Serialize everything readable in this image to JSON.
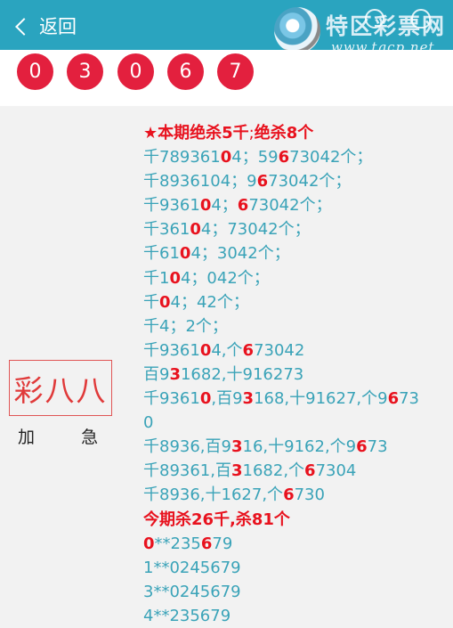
{
  "header": {
    "back_label": "返回",
    "logo_name": "特区彩票网",
    "logo_url": "www.tqcp.net"
  },
  "balls": [
    "0",
    "3",
    "0",
    "6",
    "7"
  ],
  "side": {
    "stamp": "彩八八",
    "caption_left": "加",
    "caption_right": "急"
  },
  "lines": [
    {
      "type": "title",
      "segments": [
        {
          "t": "★本期绝杀5千",
          "h": false
        },
        {
          "t": ";",
          "h": false,
          "thin": true
        },
        {
          "t": "绝杀8个",
          "h": false
        }
      ]
    },
    {
      "type": "body",
      "segments": [
        {
          "t": "千789361",
          "h": false
        },
        {
          "t": "0",
          "h": true
        },
        {
          "t": "4；59",
          "h": false
        },
        {
          "t": "6",
          "h": true
        },
        {
          "t": "73042个；",
          "h": false
        }
      ]
    },
    {
      "type": "body",
      "segments": [
        {
          "t": "千893610",
          "h": false
        },
        {
          "t": "4；9",
          "h": false
        },
        {
          "t": "6",
          "h": true
        },
        {
          "t": "73042个；",
          "h": false
        }
      ]
    },
    {
      "type": "body",
      "segments": [
        {
          "t": "千9361",
          "h": false
        },
        {
          "t": "0",
          "h": true
        },
        {
          "t": "4；",
          "h": false
        },
        {
          "t": "6",
          "h": true
        },
        {
          "t": "73042个；",
          "h": false
        }
      ]
    },
    {
      "type": "body",
      "segments": [
        {
          "t": "千361",
          "h": false
        },
        {
          "t": "0",
          "h": true
        },
        {
          "t": "4；73042个；",
          "h": false
        }
      ]
    },
    {
      "type": "body",
      "segments": [
        {
          "t": "千61",
          "h": false
        },
        {
          "t": "0",
          "h": true
        },
        {
          "t": "4；3042个；",
          "h": false
        }
      ]
    },
    {
      "type": "body",
      "segments": [
        {
          "t": "千1",
          "h": false
        },
        {
          "t": "0",
          "h": true
        },
        {
          "t": "4；042个；",
          "h": false
        }
      ]
    },
    {
      "type": "body",
      "segments": [
        {
          "t": "千",
          "h": false
        },
        {
          "t": "0",
          "h": true
        },
        {
          "t": "4；42个；",
          "h": false
        }
      ]
    },
    {
      "type": "body",
      "segments": [
        {
          "t": "千4；2个；",
          "h": false
        }
      ]
    },
    {
      "type": "body",
      "segments": [
        {
          "t": "千9361",
          "h": false
        },
        {
          "t": "0",
          "h": true
        },
        {
          "t": "4,个",
          "h": false
        },
        {
          "t": "6",
          "h": true
        },
        {
          "t": "73042",
          "h": false
        }
      ]
    },
    {
      "type": "body",
      "segments": [
        {
          "t": "百9",
          "h": false
        },
        {
          "t": "3",
          "h": true
        },
        {
          "t": "1682,十916273",
          "h": false
        }
      ]
    },
    {
      "type": "body",
      "segments": [
        {
          "t": "千9361",
          "h": false
        },
        {
          "t": "0",
          "h": true
        },
        {
          "t": ",百9",
          "h": false
        },
        {
          "t": "3",
          "h": true
        },
        {
          "t": "168,十91627,个9",
          "h": false
        },
        {
          "t": "6",
          "h": true
        },
        {
          "t": "73",
          "h": false
        }
      ]
    },
    {
      "type": "body",
      "segments": [
        {
          "t": "0",
          "h": false
        }
      ]
    },
    {
      "type": "body",
      "segments": [
        {
          "t": "千8936,百9",
          "h": false
        },
        {
          "t": "3",
          "h": true
        },
        {
          "t": "16,十9162,个9",
          "h": false
        },
        {
          "t": "6",
          "h": true
        },
        {
          "t": "73",
          "h": false
        }
      ]
    },
    {
      "type": "body",
      "segments": [
        {
          "t": "千89361,百",
          "h": false
        },
        {
          "t": "3",
          "h": true
        },
        {
          "t": "1682,个",
          "h": false
        },
        {
          "t": "6",
          "h": true
        },
        {
          "t": "7304",
          "h": false
        }
      ]
    },
    {
      "type": "body",
      "segments": [
        {
          "t": "千8936,十1627,个",
          "h": false
        },
        {
          "t": "6",
          "h": true
        },
        {
          "t": "730",
          "h": false
        }
      ]
    },
    {
      "type": "title",
      "segments": [
        {
          "t": "今期杀26千,杀81个",
          "h": false
        }
      ]
    },
    {
      "type": "body",
      "segments": [
        {
          "t": "0",
          "h": true
        },
        {
          "t": "**235",
          "h": false
        },
        {
          "t": "6",
          "h": true
        },
        {
          "t": "79",
          "h": false
        }
      ]
    },
    {
      "type": "body",
      "segments": [
        {
          "t": "1**0245679",
          "h": false
        }
      ]
    },
    {
      "type": "body",
      "segments": [
        {
          "t": "3**0245679",
          "h": false
        }
      ]
    },
    {
      "type": "body",
      "segments": [
        {
          "t": "4**235679",
          "h": false
        }
      ]
    }
  ]
}
